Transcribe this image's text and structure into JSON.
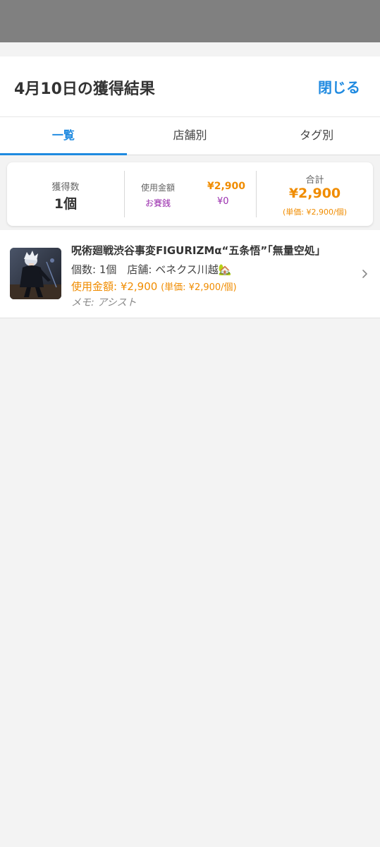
{
  "header": {
    "title": "4月10日の獲得結果",
    "close_label": "閉じる"
  },
  "tabs": [
    {
      "label": "一覧",
      "active": true
    },
    {
      "label": "店舗別",
      "active": false
    },
    {
      "label": "タグ別",
      "active": false
    }
  ],
  "summary": {
    "count_label": "獲得数",
    "count_value": "1個",
    "spent_label": "使用金額",
    "spent_value": "¥2,900",
    "offering_label": "お賽銭",
    "offering_value": "¥0",
    "total_label": "合計",
    "total_value": "¥2,900",
    "total_unit": "(単価: ¥2,900/個)"
  },
  "items": [
    {
      "title": "呪術廻戦渋谷事変FIGURIZMα“五条悟”「無量空処」",
      "meta": "個数: 1個　店舗: ベネクス川越🏡",
      "price": "使用金額: ¥2,900",
      "unit_price": "(単価: ¥2,900/個)",
      "memo": "メモ: アシスト",
      "thumbnail_icon": "figure-photo"
    }
  ],
  "colors": {
    "accent": "#1f8ae0",
    "price": "#f08c00",
    "offering": "#9b2fae",
    "overlay": "#808080"
  }
}
